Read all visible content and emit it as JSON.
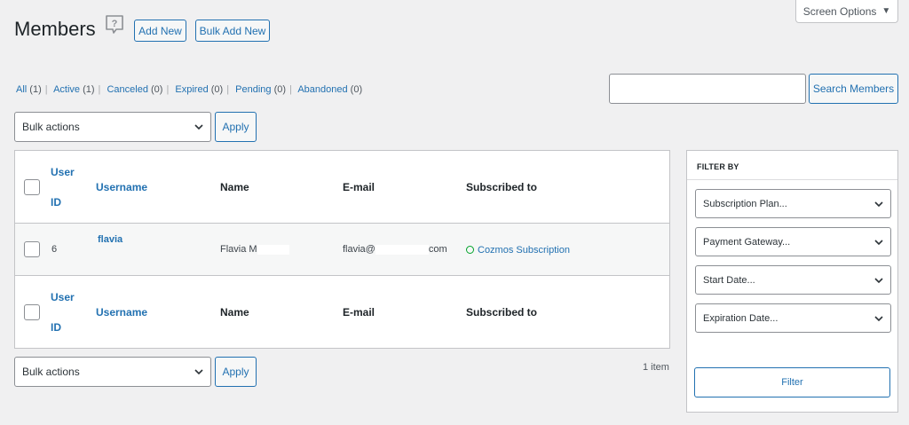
{
  "header": {
    "title": "Members",
    "add_new": "Add New",
    "bulk_add_new": "Bulk Add New",
    "screen_options": "Screen Options"
  },
  "views": [
    {
      "label": "All",
      "count": "(1)"
    },
    {
      "label": "Active",
      "count": "(1)"
    },
    {
      "label": "Canceled",
      "count": "(0)"
    },
    {
      "label": "Expired",
      "count": "(0)"
    },
    {
      "label": "Pending",
      "count": "(0)"
    },
    {
      "label": "Abandoned",
      "count": "(0)"
    }
  ],
  "search": {
    "value": "",
    "button": "Search Members"
  },
  "bulk": {
    "top_selected": "Bulk actions",
    "bottom_selected": "Bulk actions",
    "apply": "Apply"
  },
  "table": {
    "columns": {
      "user_id_1": "User",
      "user_id_2": "ID",
      "username": "Username",
      "name": "Name",
      "email": "E-mail",
      "subscribed": "Subscribed to"
    },
    "rows": [
      {
        "id": "6",
        "username": "flavia",
        "name": "Flavia M",
        "email_start": "flavia@",
        "email_end": "com",
        "subscription": "Cozmos Subscription"
      }
    ]
  },
  "pagination": {
    "count": "1 item"
  },
  "filter": {
    "title": "FILTER BY",
    "subscription_plan": "Subscription Plan...",
    "payment_gateway": "Payment Gateway...",
    "start_date": "Start Date...",
    "expiration_date": "Expiration Date...",
    "button": "Filter"
  },
  "colors": {
    "accent": "#2271b1",
    "active_status": "#00a32a",
    "background": "#f0f0f1"
  }
}
